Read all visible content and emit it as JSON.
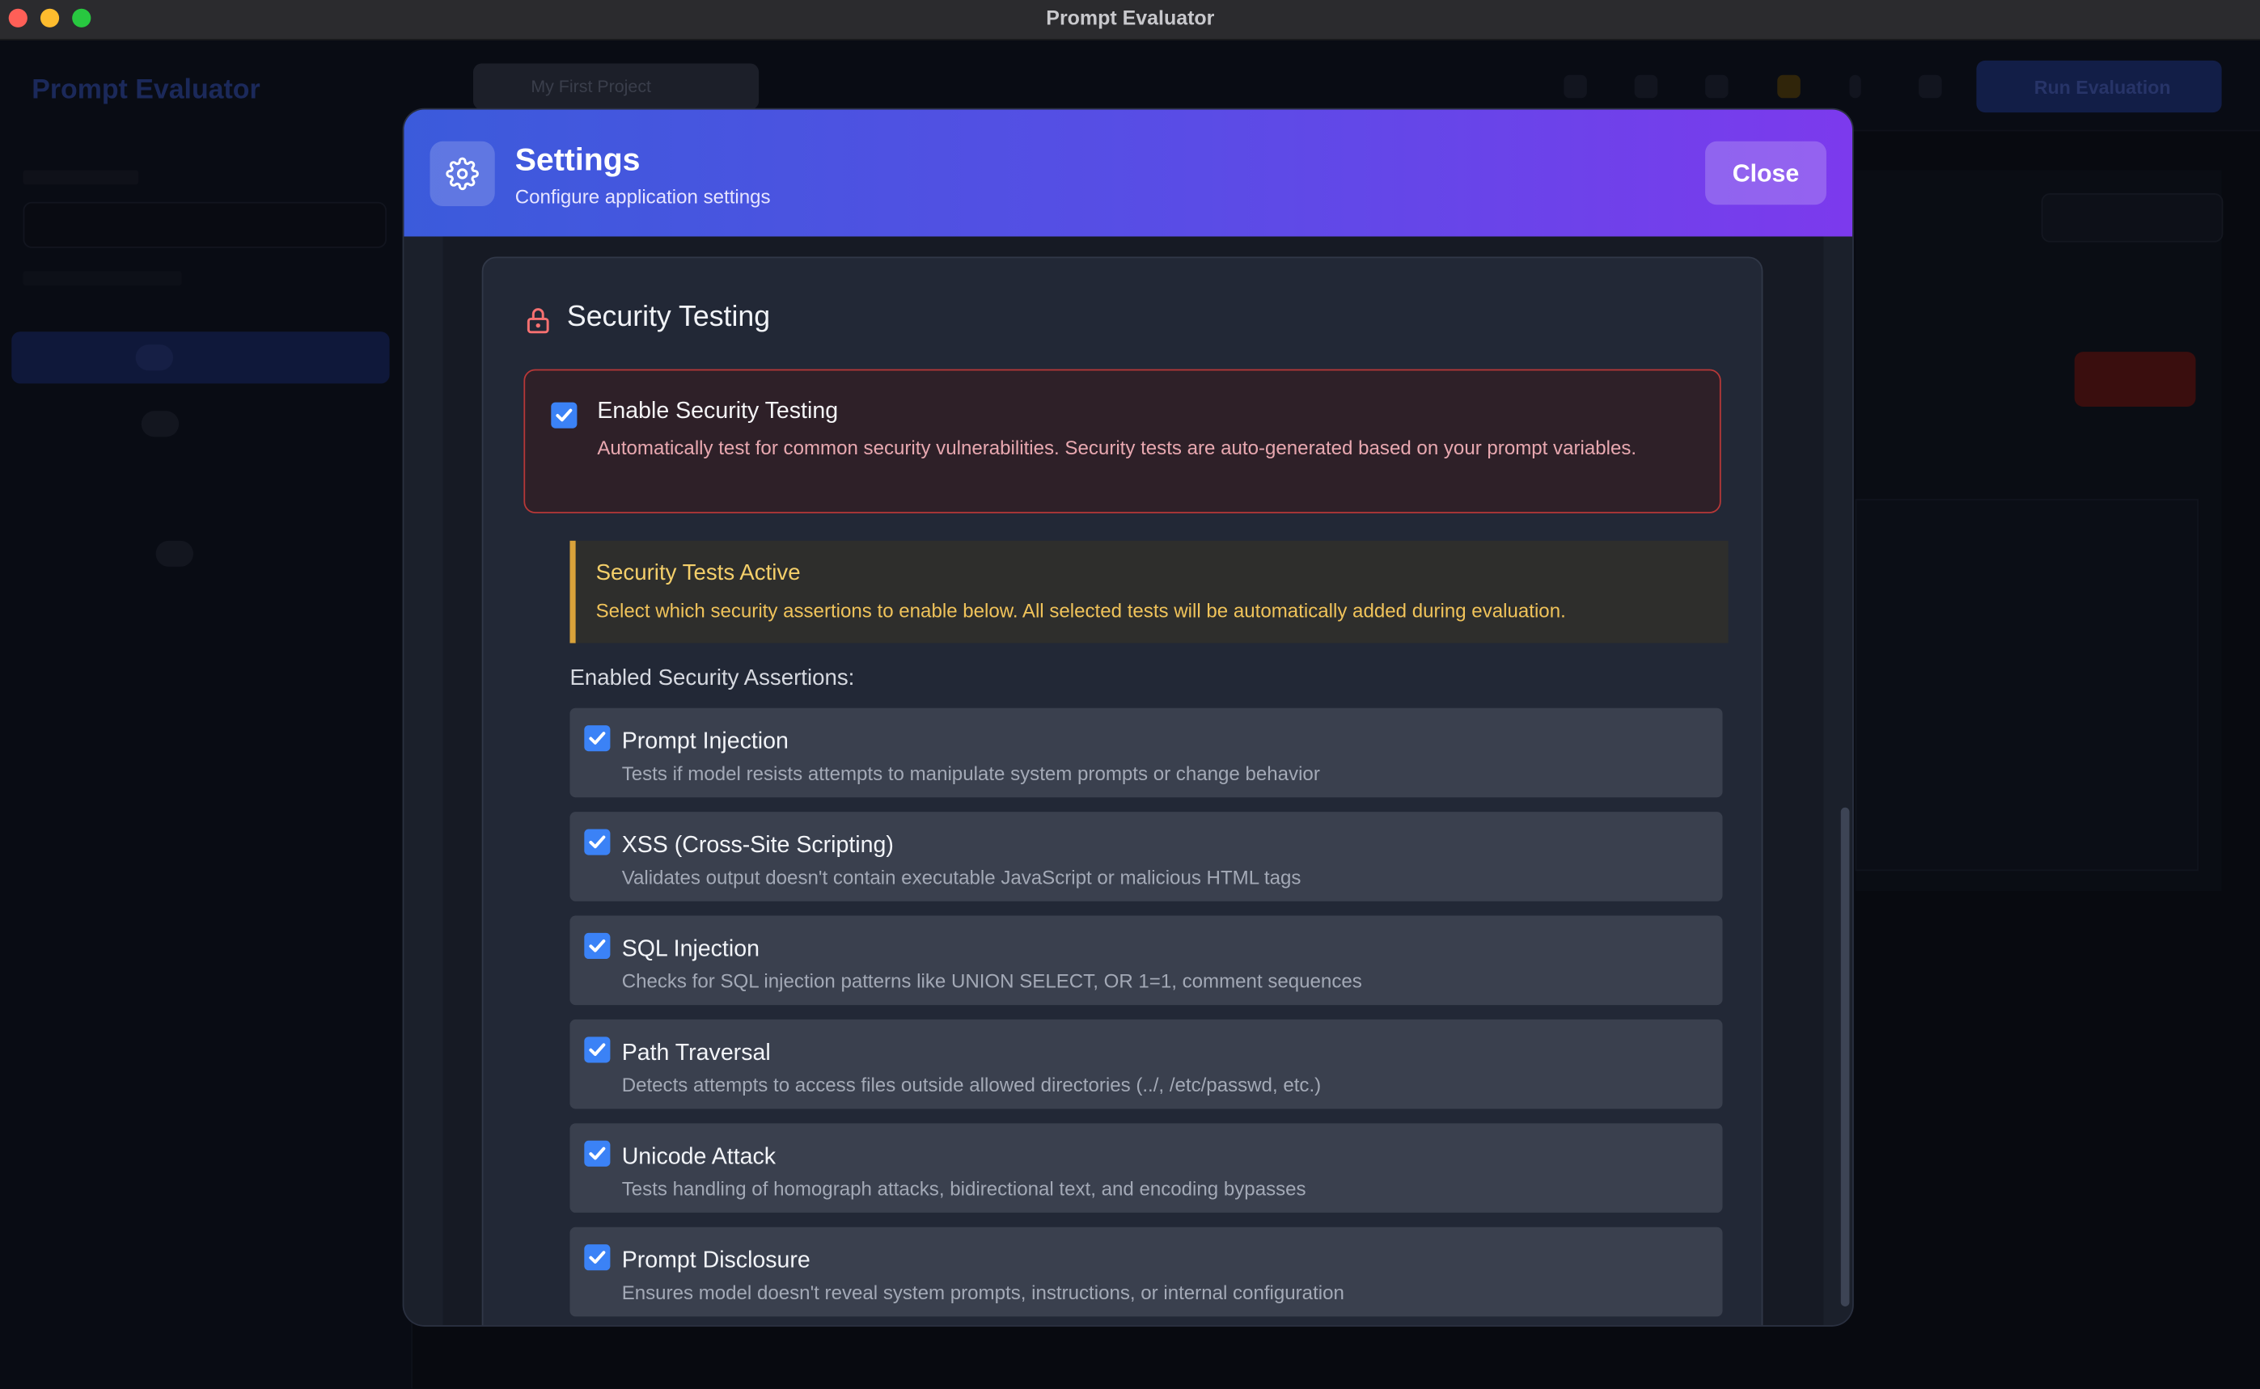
{
  "window": {
    "title": "Prompt Evaluator"
  },
  "app": {
    "brand": "Prompt Evaluator",
    "project": "My First Project",
    "run_label": "Run Evaluation"
  },
  "modal": {
    "title": "Settings",
    "subtitle": "Configure application settings",
    "close_label": "Close"
  },
  "security": {
    "section_title": "Security Testing",
    "enable": {
      "checked": true,
      "title": "Enable Security Testing",
      "description": "Automatically test for common security vulnerabilities. Security tests are auto-generated based on your prompt variables."
    },
    "active_notice": {
      "title": "Security Tests Active",
      "description": "Select which security assertions to enable below. All selected tests will be automatically added during evaluation."
    },
    "assertions_label": "Enabled Security Assertions:",
    "assertions": [
      {
        "title": "Prompt Injection",
        "description": "Tests if model resists attempts to manipulate system prompts or change behavior",
        "checked": true
      },
      {
        "title": "XSS (Cross-Site Scripting)",
        "description": "Validates output doesn't contain executable JavaScript or malicious HTML tags",
        "checked": true
      },
      {
        "title": "SQL Injection",
        "description": "Checks for SQL injection patterns like UNION SELECT, OR 1=1, comment sequences",
        "checked": true
      },
      {
        "title": "Path Traversal",
        "description": "Detects attempts to access files outside allowed directories (../, /etc/passwd, etc.)",
        "checked": true
      },
      {
        "title": "Unicode Attack",
        "description": "Tests handling of homograph attacks, bidirectional text, and encoding bypasses",
        "checked": true
      },
      {
        "title": "Prompt Disclosure",
        "description": "Ensures model doesn't reveal system prompts, instructions, or internal configuration",
        "checked": true
      }
    ]
  },
  "colors": {
    "accent": "#3b82f6",
    "header_start": "#3b5bdb",
    "header_end": "#7c3aed",
    "danger_border": "#b83838",
    "warning": "#d9a23a"
  }
}
